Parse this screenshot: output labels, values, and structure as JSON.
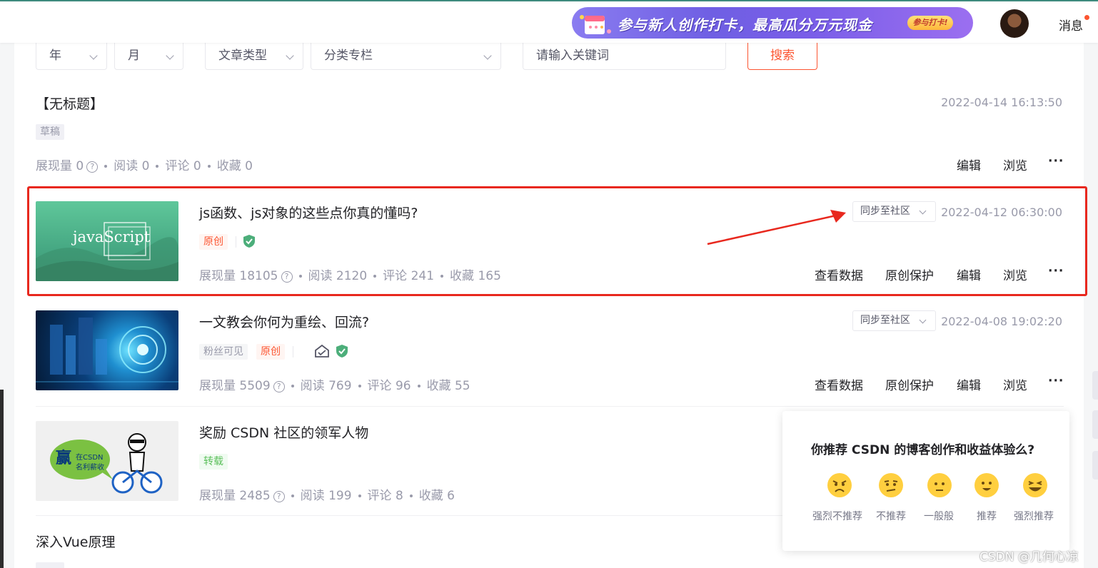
{
  "topbar": {
    "banner_text": "参与新人创作打卡，最高瓜分万元现金",
    "banner_button": "参与打卡!",
    "messages_label": "消息"
  },
  "filters": {
    "year": "年",
    "month": "月",
    "article_type": "文章类型",
    "category": "分类专栏",
    "keyword_placeholder": "请输入关键词",
    "search_button": "搜索"
  },
  "articles": [
    {
      "title": "【无标题】",
      "date": "2022-04-14 16:13:50",
      "tags": [
        "草稿"
      ],
      "stats": {
        "impressions_label": "展现量",
        "impressions": "0",
        "reads_label": "阅读",
        "reads": "0",
        "comments_label": "评论",
        "comments": "0",
        "favorites_label": "收藏",
        "favorites": "0"
      },
      "actions": [
        "编辑",
        "浏览"
      ],
      "more": "···"
    },
    {
      "title": "js函数、js对象的这些点你真的懂吗?",
      "date": "2022-04-12 06:30:00",
      "thumb_text": "javaScript",
      "sync_label": "同步至社区",
      "tags": [
        "原创"
      ],
      "stats": {
        "impressions_label": "展现量",
        "impressions": "18105",
        "reads_label": "阅读",
        "reads": "2120",
        "comments_label": "评论",
        "comments": "241",
        "favorites_label": "收藏",
        "favorites": "165"
      },
      "actions": [
        "查看数据",
        "原创保护",
        "编辑",
        "浏览"
      ],
      "more": "···"
    },
    {
      "title": "一文教会你何为重绘、回流?",
      "date": "2022-04-08 19:02:20",
      "sync_label": "同步至社区",
      "tags": [
        "粉丝可见",
        "原创"
      ],
      "stats": {
        "impressions_label": "展现量",
        "impressions": "5509",
        "reads_label": "阅读",
        "reads": "769",
        "comments_label": "评论",
        "comments": "96",
        "favorites_label": "收藏",
        "favorites": "55"
      },
      "actions": [
        "查看数据",
        "原创保护",
        "编辑",
        "浏览"
      ],
      "more": "···"
    },
    {
      "title": "奖励 CSDN 社区的领军人物",
      "thumb_text_main": "赢",
      "thumb_text_1": "在CSDN",
      "thumb_text_2": "名利薪收",
      "tags": [
        "转载"
      ],
      "stats": {
        "impressions_label": "展现量",
        "impressions": "2485",
        "reads_label": "阅读",
        "reads": "199",
        "comments_label": "评论",
        "comments": "8",
        "favorites_label": "收藏",
        "favorites": "6"
      }
    },
    {
      "title": "深入Vue原理"
    }
  ],
  "survey": {
    "question": "你推荐 CSDN 的博客创作和收益体验么?",
    "options": [
      "强烈不推荐",
      "不推荐",
      "一般般",
      "推荐",
      "强烈推荐"
    ]
  },
  "watermark": "CSDN @几何心凉",
  "colors": {
    "accent": "#fc5531",
    "highlight": "#e8281e",
    "verified": "#4cae7a"
  }
}
